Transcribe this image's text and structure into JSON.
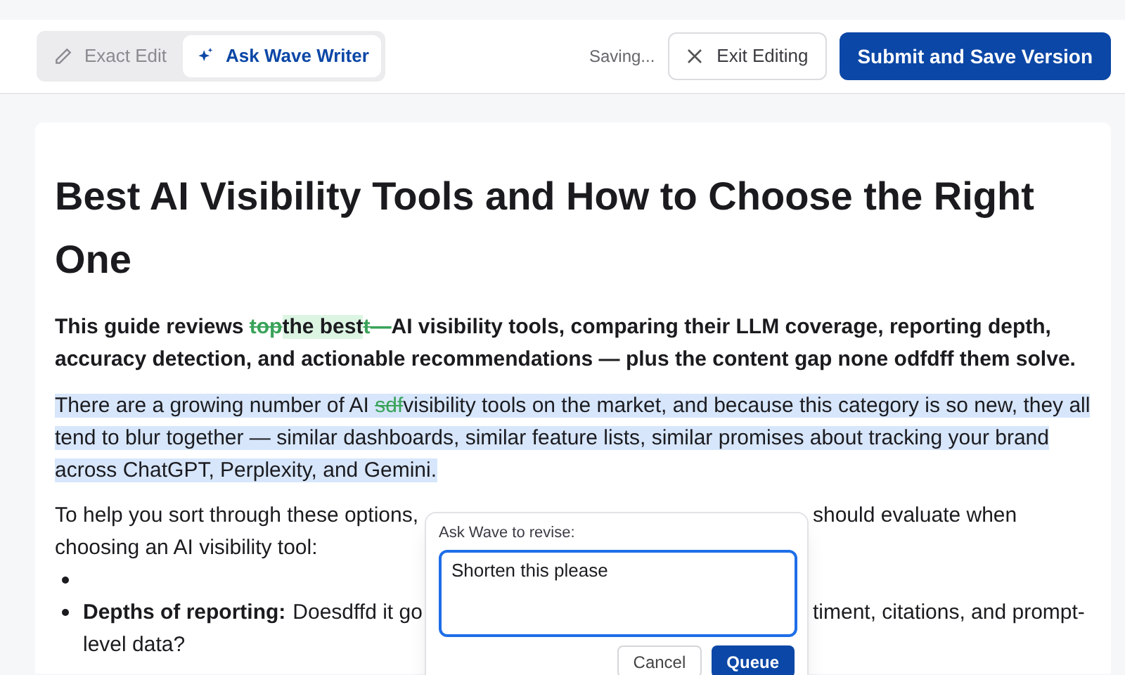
{
  "toolbar": {
    "modes": [
      {
        "label": "Exact Edit",
        "selected": false
      },
      {
        "label": "Ask Wave Writer",
        "selected": true
      }
    ],
    "status": "Saving...",
    "exit_button": "Exit Editing",
    "submit_button": "Submit and Save Version"
  },
  "document": {
    "title": "Best AI Visibility Tools and How to Choose the Right One",
    "intro": {
      "segments": [
        {
          "kind": "text",
          "text": "This guide reviews "
        },
        {
          "kind": "deleted",
          "text": "top"
        },
        {
          "kind": "inserted",
          "text": "the best"
        },
        {
          "kind": "deleted",
          "text": "t—"
        },
        {
          "kind": "text",
          "text": "AI visibility tools, comparing their LLM coverage, reporting depth, accuracy detection, and actionable recommendations — plus the content gap none odfdff them solve."
        }
      ]
    },
    "paragraph": {
      "selected": true,
      "segments": [
        {
          "kind": "text",
          "text": "There are a growing number of AI "
        },
        {
          "kind": "deleted",
          "text": "sdf"
        },
        {
          "kind": "text",
          "text": "visibility tools on the market, and because this category is so new, they all tend to blur together — similar dashboards, similar feature lists, similar promises about tracking your brand across ChatGPT, Perplexity, and Gemini."
        }
      ]
    },
    "partial_paragraph": {
      "lines": [
        {
          "left": "To help you sort through these options,",
          "right": "should evaluate when"
        },
        {
          "left": "choosing an AI visibility tool:"
        }
      ]
    },
    "bullets": [
      {
        "kind": "empty"
      },
      {
        "kind": "text",
        "label": "Depths of reporting:",
        "lines": [
          {
            "left": "Doesdffd it go",
            "right": "timent, citations, and prompt-"
          },
          {
            "left": "level data?"
          }
        ]
      }
    ]
  },
  "revise_popup": {
    "label": "Ask Wave to revise:",
    "value": "Shorten this please",
    "buttons": [
      {
        "label": "Cancel",
        "kind": "secondary"
      },
      {
        "label": "Queue",
        "kind": "primary"
      }
    ]
  }
}
